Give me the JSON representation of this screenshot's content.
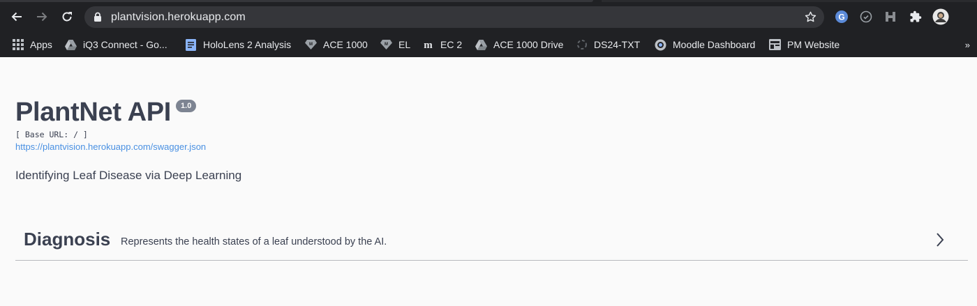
{
  "browser": {
    "url": "plantvision.herokuapp.com",
    "bookmarks": [
      {
        "label": "Apps",
        "icon": "apps-grid-icon"
      },
      {
        "label": "iQ3 Connect - Go...",
        "icon": "drive-icon"
      },
      {
        "label": "HoloLens 2 Analysis",
        "icon": "docs-icon"
      },
      {
        "label": "ACE 1000",
        "icon": "gem-icon"
      },
      {
        "label": "EL",
        "icon": "gem-icon"
      },
      {
        "label": "EC 2",
        "icon": "m-logo-icon"
      },
      {
        "label": "ACE 1000 Drive",
        "icon": "drive-icon"
      },
      {
        "label": "DS24-TXT",
        "icon": "loader-icon"
      },
      {
        "label": "Moodle Dashboard",
        "icon": "moodle-icon"
      },
      {
        "label": "PM Website",
        "icon": "site-icon"
      }
    ],
    "more_label": "»"
  },
  "page": {
    "title": "PlantNet API",
    "version": "1.0",
    "base_url": "[ Base URL: / ]",
    "spec_link": "https://plantvision.herokuapp.com/swagger.json",
    "description": "Identifying Leaf Disease via Deep Learning",
    "tags": [
      {
        "name": "Diagnosis",
        "description": "Represents the health states of a leaf understood by the AI."
      }
    ]
  },
  "colors": {
    "chrome_bg": "#202124",
    "page_bg": "#fafafa",
    "text": "#3b4151",
    "link": "#4990e2"
  }
}
